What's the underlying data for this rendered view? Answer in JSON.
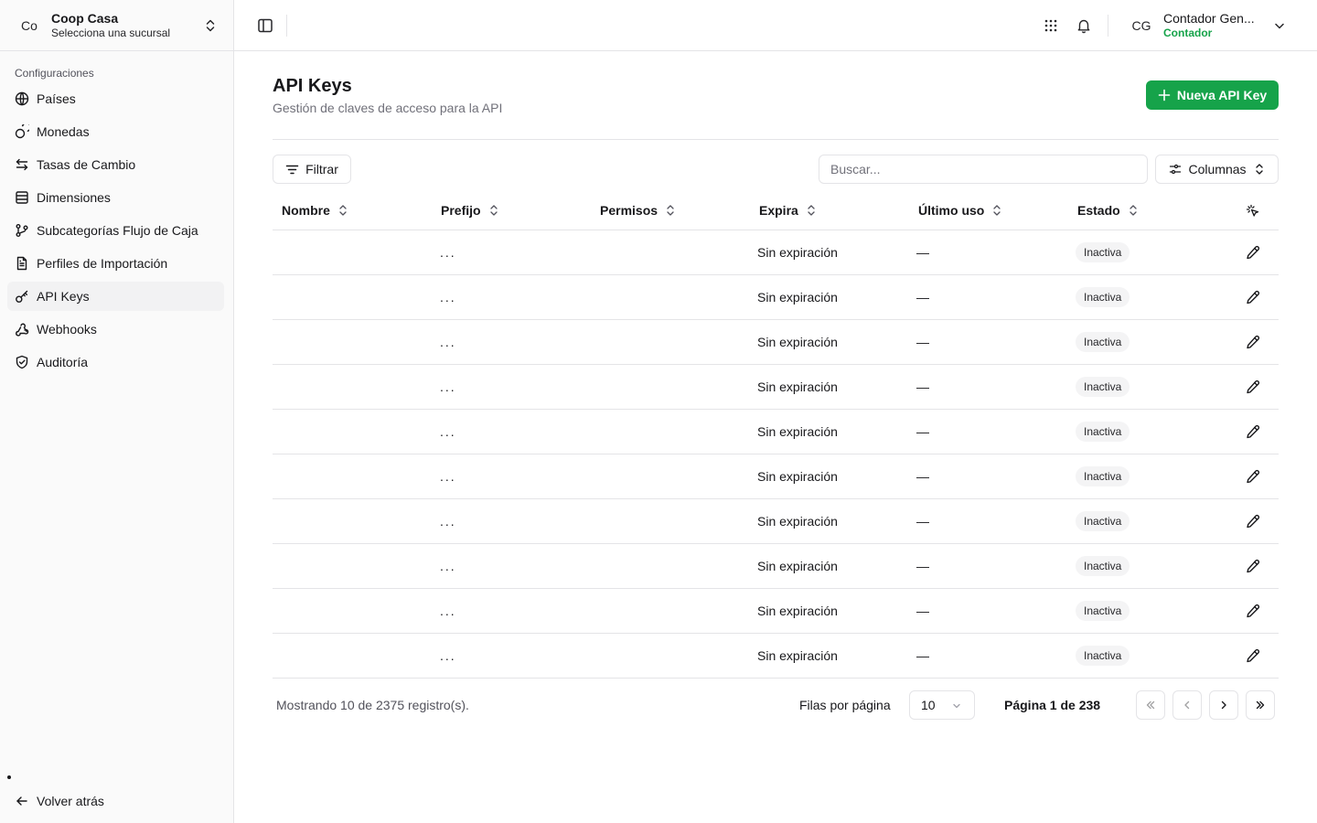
{
  "org": {
    "avatar": "Co",
    "name": "Coop Casa",
    "subtitle": "Selecciona una sucursal"
  },
  "sidebar": {
    "group_label": "Configuraciones",
    "items": [
      {
        "label": "Países",
        "icon": "globe-icon"
      },
      {
        "label": "Monedas",
        "icon": "coins-icon"
      },
      {
        "label": "Tasas de Cambio",
        "icon": "arrows-exchange-icon"
      },
      {
        "label": "Dimensiones",
        "icon": "database-icon"
      },
      {
        "label": "Subcategorías Flujo de Caja",
        "icon": "git-branch-icon"
      },
      {
        "label": "Perfiles de Importación",
        "icon": "file-text-icon"
      },
      {
        "label": "API Keys",
        "icon": "key-icon",
        "active": true
      },
      {
        "label": "Webhooks",
        "icon": "webhook-icon"
      },
      {
        "label": "Auditoría",
        "icon": "shield-check-icon"
      }
    ],
    "back_label": "Volver atrás"
  },
  "user": {
    "avatar": "CG",
    "name": "Contador Gen...",
    "role": "Contador"
  },
  "page": {
    "title": "API Keys",
    "subtitle": "Gestión de claves de acceso para la API",
    "new_button": "Nueva API Key"
  },
  "toolbar": {
    "filter_label": "Filtrar",
    "search_placeholder": "Buscar...",
    "columns_label": "Columnas"
  },
  "table": {
    "columns": [
      "Nombre",
      "Prefijo",
      "Permisos",
      "Expira",
      "Último uso",
      "Estado"
    ],
    "rows": [
      {
        "nombre": "",
        "prefijo": "...",
        "permisos": "",
        "expira": "Sin expiración",
        "ultimo_uso": "—",
        "estado": "Inactiva"
      },
      {
        "nombre": "",
        "prefijo": "...",
        "permisos": "",
        "expira": "Sin expiración",
        "ultimo_uso": "—",
        "estado": "Inactiva"
      },
      {
        "nombre": "",
        "prefijo": "...",
        "permisos": "",
        "expira": "Sin expiración",
        "ultimo_uso": "—",
        "estado": "Inactiva"
      },
      {
        "nombre": "",
        "prefijo": "...",
        "permisos": "",
        "expira": "Sin expiración",
        "ultimo_uso": "—",
        "estado": "Inactiva"
      },
      {
        "nombre": "",
        "prefijo": "...",
        "permisos": "",
        "expira": "Sin expiración",
        "ultimo_uso": "—",
        "estado": "Inactiva"
      },
      {
        "nombre": "",
        "prefijo": "...",
        "permisos": "",
        "expira": "Sin expiración",
        "ultimo_uso": "—",
        "estado": "Inactiva"
      },
      {
        "nombre": "",
        "prefijo": "...",
        "permisos": "",
        "expira": "Sin expiración",
        "ultimo_uso": "—",
        "estado": "Inactiva"
      },
      {
        "nombre": "",
        "prefijo": "...",
        "permisos": "",
        "expira": "Sin expiración",
        "ultimo_uso": "—",
        "estado": "Inactiva"
      },
      {
        "nombre": "",
        "prefijo": "...",
        "permisos": "",
        "expira": "Sin expiración",
        "ultimo_uso": "—",
        "estado": "Inactiva"
      },
      {
        "nombre": "",
        "prefijo": "...",
        "permisos": "",
        "expira": "Sin expiración",
        "ultimo_uso": "—",
        "estado": "Inactiva"
      }
    ]
  },
  "pagination": {
    "showing": "Mostrando 10 de 2375 registro(s).",
    "rows_per_page_label": "Filas por página",
    "rows_per_page_value": "10",
    "page_label": "Página 1 de 238"
  },
  "colors": {
    "accent": "#16a34a",
    "border": "#e4e4e7",
    "muted": "#71717a"
  }
}
